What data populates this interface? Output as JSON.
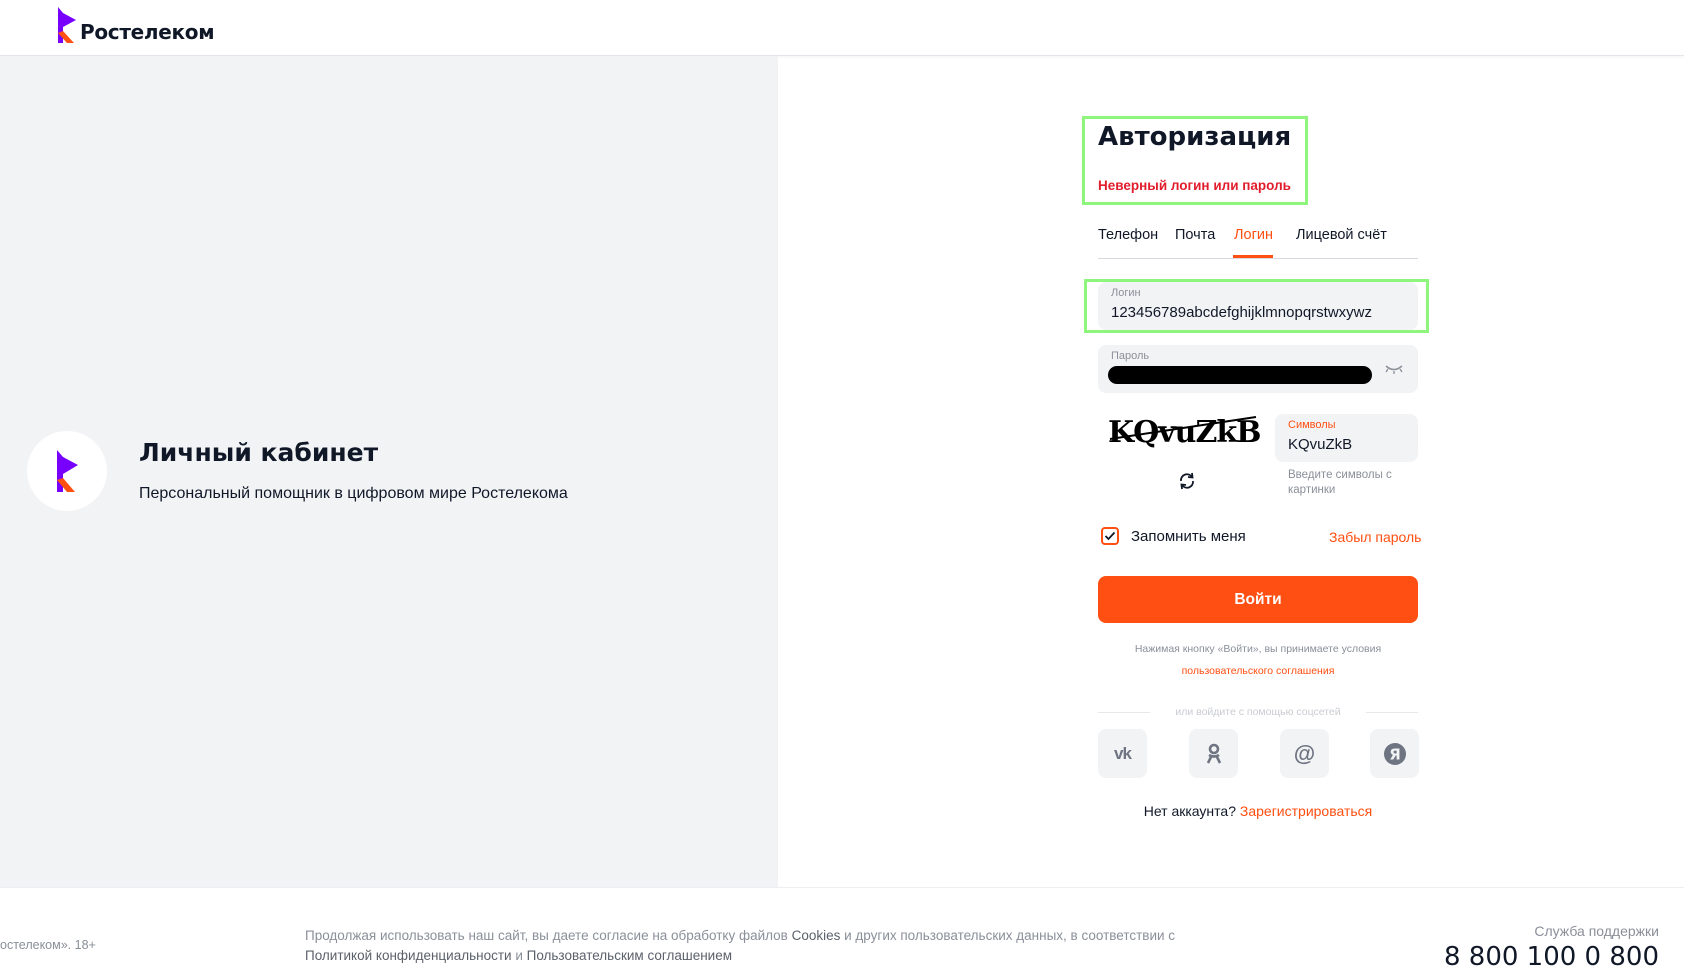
{
  "header": {
    "logo_text": "Ростелеком"
  },
  "promo": {
    "title": "Личный кабинет",
    "subtitle": "Персональный помощник в цифровом мире Ростелекома"
  },
  "auth": {
    "title": "Авторизация",
    "error": "Неверный логин или пароль",
    "tabs": [
      {
        "label": "Телефон",
        "active": false
      },
      {
        "label": "Почта",
        "active": false
      },
      {
        "label": "Логин",
        "active": true
      },
      {
        "label": "Лицевой счёт",
        "active": false
      }
    ],
    "login": {
      "label": "Логин",
      "value": "123456789abcdefghijklmnopqrstwxywz"
    },
    "password": {
      "label": "Пароль",
      "value": "masked"
    },
    "captcha": {
      "image_text": "KQvuZkB",
      "label": "Символы",
      "value": "KQvuZkB",
      "hint": "Введите символы с картинки"
    },
    "remember_label": "Запомнить меня",
    "remember_checked": true,
    "forgot_label": "Забыл пароль",
    "submit_label": "Войти",
    "terms_text": "Нажимая кнопку «Войти», вы принимаете условия",
    "terms_link": "пользовательского соглашения",
    "social_divider": "или войдите с помощью соцсетей",
    "social": [
      {
        "name": "vk",
        "glyph": "vk-icon"
      },
      {
        "name": "ok",
        "glyph": "odnoklassniki-icon"
      },
      {
        "name": "mail",
        "glyph": "at-icon"
      },
      {
        "name": "yandex",
        "glyph": "yandex-icon"
      }
    ],
    "register_prompt": "Нет аккаунта?",
    "register_link": "Зарегистрироваться"
  },
  "footer": {
    "copyright": "остелеком». 18+",
    "cookie_text_1": "Продолжая использовать наш сайт, вы даете согласие на обработку файлов ",
    "cookie_word": "Cookies",
    "cookie_text_2": " и других пользовательских данных, в соответствии с",
    "privacy_link": "Политикой конфиденциальности",
    "and": " и ",
    "agreement_link": "Пользовательским соглашением",
    "support_label": "Служба поддержки",
    "support_phone": "8 800 100 0 800"
  },
  "colors": {
    "brand_orange": "#ff4f12",
    "brand_purple": "#7700ff",
    "error": "#e11d2c",
    "highlight": "#8ef57d"
  }
}
